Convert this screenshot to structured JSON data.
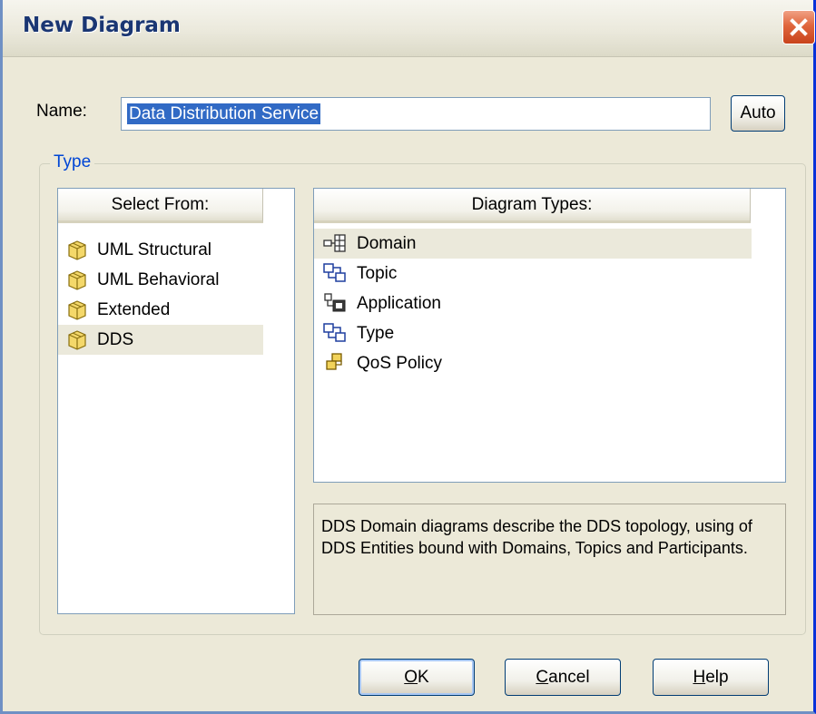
{
  "window": {
    "title": "New Diagram"
  },
  "name_field": {
    "label": "Name:",
    "value": "Data Distribution Service"
  },
  "auto_button": "Auto",
  "type_group": {
    "label": "Type",
    "select_from": {
      "header": "Select From:",
      "items": [
        {
          "label": "UML Structural",
          "icon": "folder-icon"
        },
        {
          "label": "UML Behavioral",
          "icon": "folder-icon"
        },
        {
          "label": "Extended",
          "icon": "folder-icon"
        },
        {
          "label": "DDS",
          "icon": "folder-icon",
          "selected": true
        }
      ]
    },
    "diagram_types": {
      "header": "Diagram Types:",
      "items": [
        {
          "label": "Domain",
          "icon": "domain-diagram-icon",
          "selected": true
        },
        {
          "label": "Topic",
          "icon": "topic-diagram-icon"
        },
        {
          "label": "Application",
          "icon": "application-diagram-icon"
        },
        {
          "label": "Type",
          "icon": "type-diagram-icon"
        },
        {
          "label": "QoS Policy",
          "icon": "qos-policy-diagram-icon"
        }
      ]
    },
    "description": "DDS Domain diagrams describe the DDS topology, using of DDS Entities bound with Domains, Topics and Participants."
  },
  "buttons": {
    "ok": {
      "mnemonic": "O",
      "rest": "K"
    },
    "cancel": {
      "mnemonic": "C",
      "rest": "ancel"
    },
    "help": {
      "mnemonic": "H",
      "rest": "elp"
    }
  },
  "colors": {
    "selection": "#316ac5",
    "title_text": "#1a3673",
    "group_label": "#0046d5",
    "close_button": "#e0663d"
  }
}
